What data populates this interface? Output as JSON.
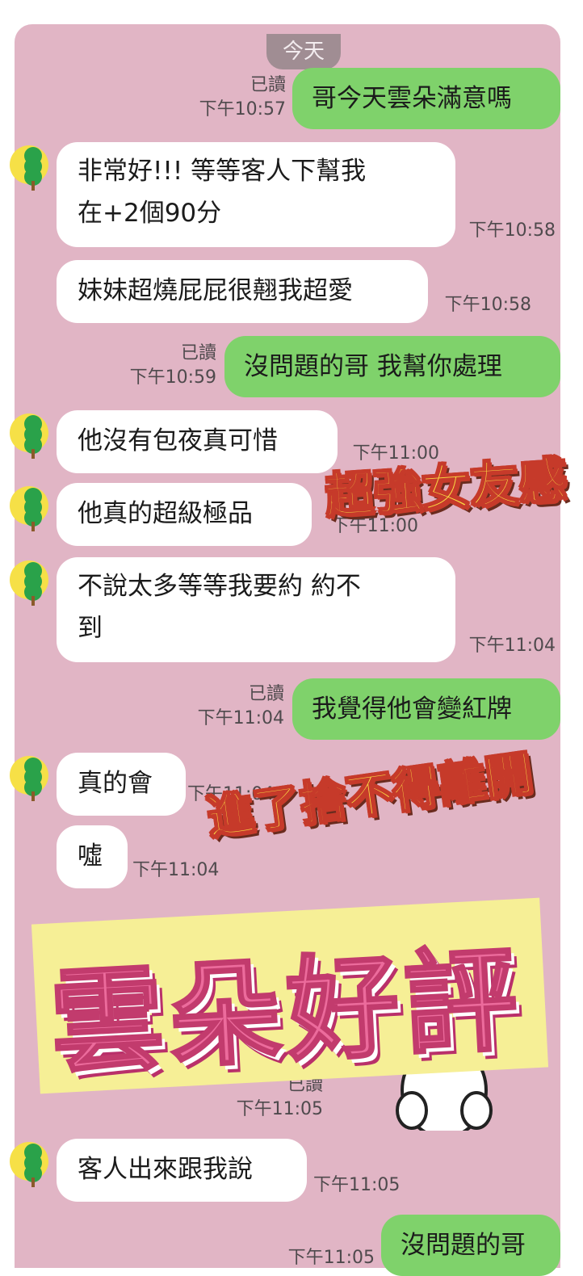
{
  "date_label": "今天",
  "messages": [
    {
      "text": "哥今天雲朵滿意嗎",
      "read": "已讀",
      "time": "下午10:57"
    },
    {
      "text": "非常好!!! 等等客人下幫我",
      "text2": "在+2個90分",
      "time": "下午10:58"
    },
    {
      "text": "妹妹超燒屁屁很翹我超愛",
      "time": "下午10:58"
    },
    {
      "text": "沒問題的哥 我幫你處理",
      "read": "已讀",
      "time": "下午10:59"
    },
    {
      "text": "他沒有包夜真可惜",
      "time": "下午11:00"
    },
    {
      "text": "他真的超級極品",
      "time": "下午11:00"
    },
    {
      "text": "不說太多等等我要約 約不",
      "text2": "到",
      "time": "下午11:04"
    },
    {
      "text": "我覺得他會變紅牌",
      "read": "已讀",
      "time": "下午11:04"
    },
    {
      "text": "真的會",
      "time": "下午11:04"
    },
    {
      "text": "噓",
      "time": "下午11:04"
    },
    {
      "read": "已讀",
      "time": "下午11:05"
    },
    {
      "text": "客人出來跟我說",
      "time": "下午11:05"
    },
    {
      "text": "沒問題的哥",
      "time": "下午11:05"
    }
  ],
  "overlays": {
    "sticker1": "超強女友感",
    "sticker2": "進了捨不得離開",
    "banner": "雲朵好評"
  },
  "colors": {
    "chat_bg": "#e1b5c5",
    "outgoing": "#7fd26b",
    "incoming": "#ffffff",
    "banner_bg": "#f6ef96",
    "banner_text": "#ec6b9c"
  }
}
